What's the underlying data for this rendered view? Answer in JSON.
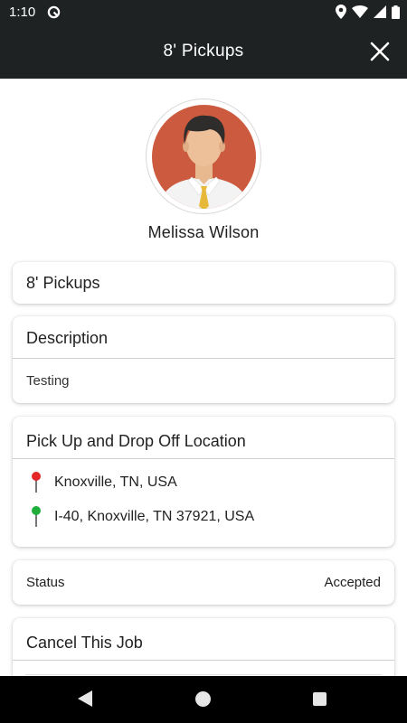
{
  "status_bar": {
    "time": "1:10",
    "icons": [
      "sync-icon",
      "location-icon",
      "wifi-icon",
      "signal-icon",
      "battery-icon"
    ]
  },
  "app_bar": {
    "title": "8' Pickups",
    "close_icon": "close-icon"
  },
  "profile": {
    "name": "Melissa Wilson",
    "avatar": "avatar-illustration"
  },
  "job": {
    "title": "8' Pickups",
    "description_header": "Description",
    "description_text": "Testing",
    "location_header": "Pick Up and Drop Off Location",
    "pickup_location": "Knoxville, TN, USA",
    "dropoff_location": "I-40, Knoxville, TN 37921, USA",
    "status_label": "Status",
    "status_value": "Accepted",
    "cancel_header": "Cancel This Job"
  },
  "colors": {
    "app_bar": "#1f2222",
    "pickup_pin": "#e32626",
    "dropoff_pin": "#1fae3a",
    "avatar_bg": "#cc5a3f"
  },
  "nav_bar": {
    "icons": [
      "back-icon",
      "home-icon",
      "recent-apps-icon"
    ]
  }
}
